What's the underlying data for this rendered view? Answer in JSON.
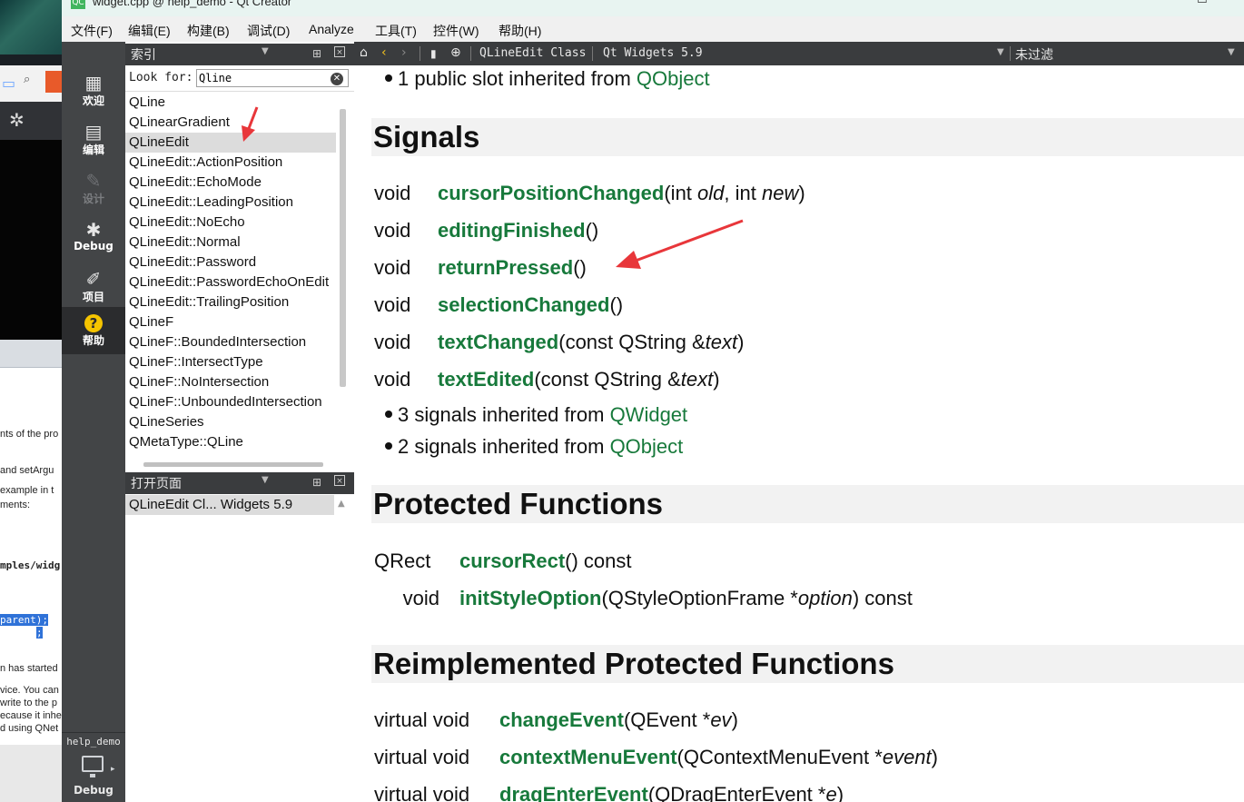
{
  "window": {
    "title": "widget.cpp @ help_demo - Qt Creator",
    "app_icon_text": "QC"
  },
  "menu": [
    "文件(F)",
    "编辑(E)",
    "构建(B)",
    "调试(D)",
    "Analyze",
    "工具(T)",
    "控件(W)",
    "帮助(H)"
  ],
  "modes": [
    {
      "label": "欢迎",
      "icon": "grid-icon"
    },
    {
      "label": "编辑",
      "icon": "document-icon"
    },
    {
      "label": "设计",
      "icon": "pencil-icon",
      "disabled": true
    },
    {
      "label": "Debug",
      "icon": "bug-icon"
    },
    {
      "label": "项目",
      "icon": "wrench-icon"
    },
    {
      "label": "帮助",
      "icon": "help-icon",
      "active": true
    }
  ],
  "kit": {
    "project": "help_demo",
    "build_label": "Debug"
  },
  "index_pane": {
    "header": "索引",
    "look_for_label": "Look for:",
    "search_value": "Qline",
    "items": [
      "QLine",
      "QLinearGradient",
      "QLineEdit",
      "QLineEdit::ActionPosition",
      "QLineEdit::EchoMode",
      "QLineEdit::LeadingPosition",
      "QLineEdit::NoEcho",
      "QLineEdit::Normal",
      "QLineEdit::Password",
      "QLineEdit::PasswordEchoOnEdit",
      "QLineEdit::TrailingPosition",
      "QLineF",
      "QLineF::BoundedIntersection",
      "QLineF::IntersectType",
      "QLineF::NoIntersection",
      "QLineF::UnboundedIntersection",
      "QLineSeries",
      "QMetaType::QLine"
    ],
    "selected_index": 2
  },
  "open_pages": {
    "header": "打开页面",
    "items": [
      "QLineEdit Cl... Widgets 5.9"
    ]
  },
  "help_toolbar": {
    "doc_title": "QLineEdit Class",
    "doc_module": "Qt Widgets 5.9",
    "filter": "未过滤"
  },
  "doc": {
    "top_bullet": {
      "text": "1 public slot inherited from ",
      "link": "QObject"
    },
    "signals_heading": "Signals",
    "signals": [
      {
        "ret": "void",
        "name": "cursorPositionChanged",
        "p1": "(int ",
        "a1": "old",
        "p2": ", int ",
        "a2": "new",
        "p3": ")"
      },
      {
        "ret": "void",
        "name": "editingFinished",
        "p1": "()",
        "a1": "",
        "p2": "",
        "a2": "",
        "p3": ""
      },
      {
        "ret": "void",
        "name": "returnPressed",
        "p1": "()",
        "a1": "",
        "p2": "",
        "a2": "",
        "p3": ""
      },
      {
        "ret": "void",
        "name": "selectionChanged",
        "p1": "()",
        "a1": "",
        "p2": "",
        "a2": "",
        "p3": ""
      },
      {
        "ret": "void",
        "name": "textChanged",
        "p1": "(const QString &",
        "a1": "text",
        "p2": ")",
        "a2": "",
        "p3": ""
      },
      {
        "ret": "void",
        "name": "textEdited",
        "p1": "(const QString &",
        "a1": "text",
        "p2": ")",
        "a2": "",
        "p3": ""
      }
    ],
    "inherited": [
      {
        "text": "3 signals inherited from ",
        "link": "QWidget"
      },
      {
        "text": "2 signals inherited from ",
        "link": "QObject"
      }
    ],
    "protected_heading": "Protected Functions",
    "protected": [
      {
        "ret": "QRect",
        "name": "cursorRect",
        "p1": "() const",
        "a1": "",
        "p2": ""
      },
      {
        "ret": "void",
        "name": "initStyleOption",
        "p1": "(QStyleOptionFrame *",
        "a1": "option",
        "p2": ") const"
      }
    ],
    "reimpl_heading": "Reimplemented Protected Functions",
    "reimpl": [
      {
        "ret": "virtual void",
        "name": "changeEvent",
        "p1": "(QEvent *",
        "a1": "ev",
        "p2": ")"
      },
      {
        "ret": "virtual void",
        "name": "contextMenuEvent",
        "p1": "(QContextMenuEvent *",
        "a1": "event",
        "p2": ")"
      },
      {
        "ret": "virtual void",
        "name": "dragEnterEvent",
        "p1": "(QDragEnterEvent *",
        "a1": "e",
        "p2": ")"
      }
    ]
  },
  "background_window": {
    "snippets": [
      "nts of the pro",
      "and ",
      "setArgu",
      " example in t",
      "ments:",
      "mples/widg",
      "parent);",
      ";",
      "n has started",
      "vice. You can",
      " write to the p",
      "ecause it inhe",
      "d using ",
      "QNet"
    ]
  },
  "colors": {
    "link": "#17793b",
    "annotation": "#e8363a",
    "modebar": "#434547"
  }
}
